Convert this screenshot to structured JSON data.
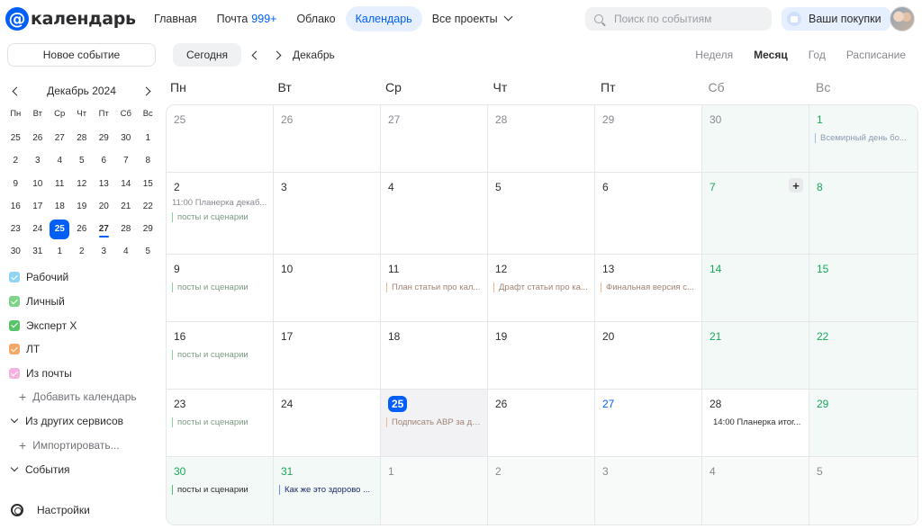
{
  "logo": {
    "symbol": "@",
    "text": "календарь"
  },
  "nav": {
    "items": [
      {
        "label": "Главная"
      },
      {
        "label": "Почта",
        "badge": "999+"
      },
      {
        "label": "Облако"
      },
      {
        "label": "Календарь",
        "active": true
      },
      {
        "label": "Все проекты"
      }
    ]
  },
  "search": {
    "placeholder": "Поиск по событиям"
  },
  "purchases": {
    "label": "Ваши покупки"
  },
  "sidebar": {
    "new_event": "Новое событие",
    "mini_calendar": {
      "title": "Декабрь 2024",
      "weekdays": [
        "Пн",
        "Вт",
        "Ср",
        "Чт",
        "Пт",
        "Сб",
        "Вс"
      ],
      "days": [
        "25",
        "26",
        "27",
        "28",
        "29",
        "30",
        "1",
        "2",
        "3",
        "4",
        "5",
        "6",
        "7",
        "8",
        "9",
        "10",
        "11",
        "12",
        "13",
        "14",
        "15",
        "16",
        "17",
        "18",
        "19",
        "20",
        "21",
        "22",
        "23",
        "24",
        "25",
        "26",
        "27",
        "28",
        "29",
        "30",
        "31",
        "1",
        "2",
        "3",
        "4",
        "5"
      ],
      "selected_index": 30,
      "today_index": 32
    },
    "calendars": [
      {
        "label": "Рабочий",
        "color": "#8fd3f5"
      },
      {
        "label": "Личный",
        "color": "#7dd487"
      },
      {
        "label": "Эксперт Х",
        "color": "#59c36a"
      },
      {
        "label": "ЛТ",
        "color": "#f4a868"
      },
      {
        "label": "Из почты",
        "color": "#f5b3dd"
      }
    ],
    "add_calendar": "Добавить календарь",
    "other_services": "Из других сервисов",
    "import": "Импортировать...",
    "events_section": "События",
    "settings": "Настройки"
  },
  "toolbar": {
    "today": "Сегодня",
    "month": "Декабрь",
    "views": [
      {
        "label": "Неделя"
      },
      {
        "label": "Месяц",
        "active": true
      },
      {
        "label": "Год"
      },
      {
        "label": "Расписание"
      }
    ]
  },
  "month_grid": {
    "weekdays": [
      "Пн",
      "Вт",
      "Ср",
      "Чт",
      "Пт",
      "Сб",
      "Вс"
    ],
    "weeks": [
      [
        {
          "day": "25",
          "style": "muted"
        },
        {
          "day": "26",
          "style": "muted"
        },
        {
          "day": "27",
          "style": "muted"
        },
        {
          "day": "28",
          "style": "muted"
        },
        {
          "day": "29",
          "style": "muted"
        },
        {
          "day": "30",
          "style": "muted",
          "weekend": true
        },
        {
          "day": "1",
          "style": "green",
          "weekend": true,
          "events": [
            {
              "text": "Всемирный день бо...",
              "kind": "blue"
            }
          ]
        }
      ],
      [
        {
          "day": "2",
          "events": [
            {
              "text": "11:00 Планерка декаб...",
              "kind": "time"
            },
            {
              "text": "посты и сценарии",
              "kind": "green"
            }
          ]
        },
        {
          "day": "3"
        },
        {
          "day": "4"
        },
        {
          "day": "5"
        },
        {
          "day": "6"
        },
        {
          "day": "7",
          "style": "green",
          "weekend": true,
          "plus": "+"
        },
        {
          "day": "8",
          "style": "green",
          "weekend": true
        }
      ],
      [
        {
          "day": "9",
          "events": [
            {
              "text": "посты и сценарии",
              "kind": "green"
            }
          ]
        },
        {
          "day": "10"
        },
        {
          "day": "11",
          "events": [
            {
              "text": "План статьи про кал...",
              "kind": "orange"
            }
          ]
        },
        {
          "day": "12",
          "events": [
            {
              "text": "Драфт статьи про ка...",
              "kind": "orange"
            }
          ]
        },
        {
          "day": "13",
          "events": [
            {
              "text": "Финальная версия с...",
              "kind": "orange"
            }
          ]
        },
        {
          "day": "14",
          "style": "green",
          "weekend": true
        },
        {
          "day": "15",
          "style": "green",
          "weekend": true
        }
      ],
      [
        {
          "day": "16",
          "events": [
            {
              "text": "посты и сценарии",
              "kind": "green"
            }
          ]
        },
        {
          "day": "17"
        },
        {
          "day": "18"
        },
        {
          "day": "19"
        },
        {
          "day": "20"
        },
        {
          "day": "21",
          "style": "green",
          "weekend": true
        },
        {
          "day": "22",
          "style": "green",
          "weekend": true
        }
      ],
      [
        {
          "day": "23",
          "events": [
            {
              "text": "посты и сценарии",
              "kind": "green"
            }
          ]
        },
        {
          "day": "24"
        },
        {
          "day": "25",
          "style": "sel",
          "current": true,
          "events": [
            {
              "text": "Подписать АВР за де...",
              "kind": "orange"
            }
          ]
        },
        {
          "day": "26"
        },
        {
          "day": "27",
          "style": "blue"
        },
        {
          "day": "28",
          "events": [
            {
              "text": "14:00 Планерка итог...",
              "kind": "dark"
            }
          ]
        },
        {
          "day": "29",
          "style": "green",
          "weekend": true
        }
      ],
      [
        {
          "day": "30",
          "style": "green",
          "weekend": true,
          "events": [
            {
              "text": "посты и сценарии",
              "kind": "dgreen"
            }
          ]
        },
        {
          "day": "31",
          "style": "green",
          "weekend": true,
          "events": [
            {
              "text": "Как же это здорово ...",
              "kind": "dblue"
            }
          ]
        },
        {
          "day": "1",
          "style": "muted",
          "mbg": true
        },
        {
          "day": "2",
          "style": "muted",
          "mbg": true
        },
        {
          "day": "3",
          "style": "muted",
          "mbg": true
        },
        {
          "day": "4",
          "style": "muted",
          "mbg": true
        },
        {
          "day": "5",
          "style": "muted",
          "mbg": true
        }
      ]
    ]
  }
}
